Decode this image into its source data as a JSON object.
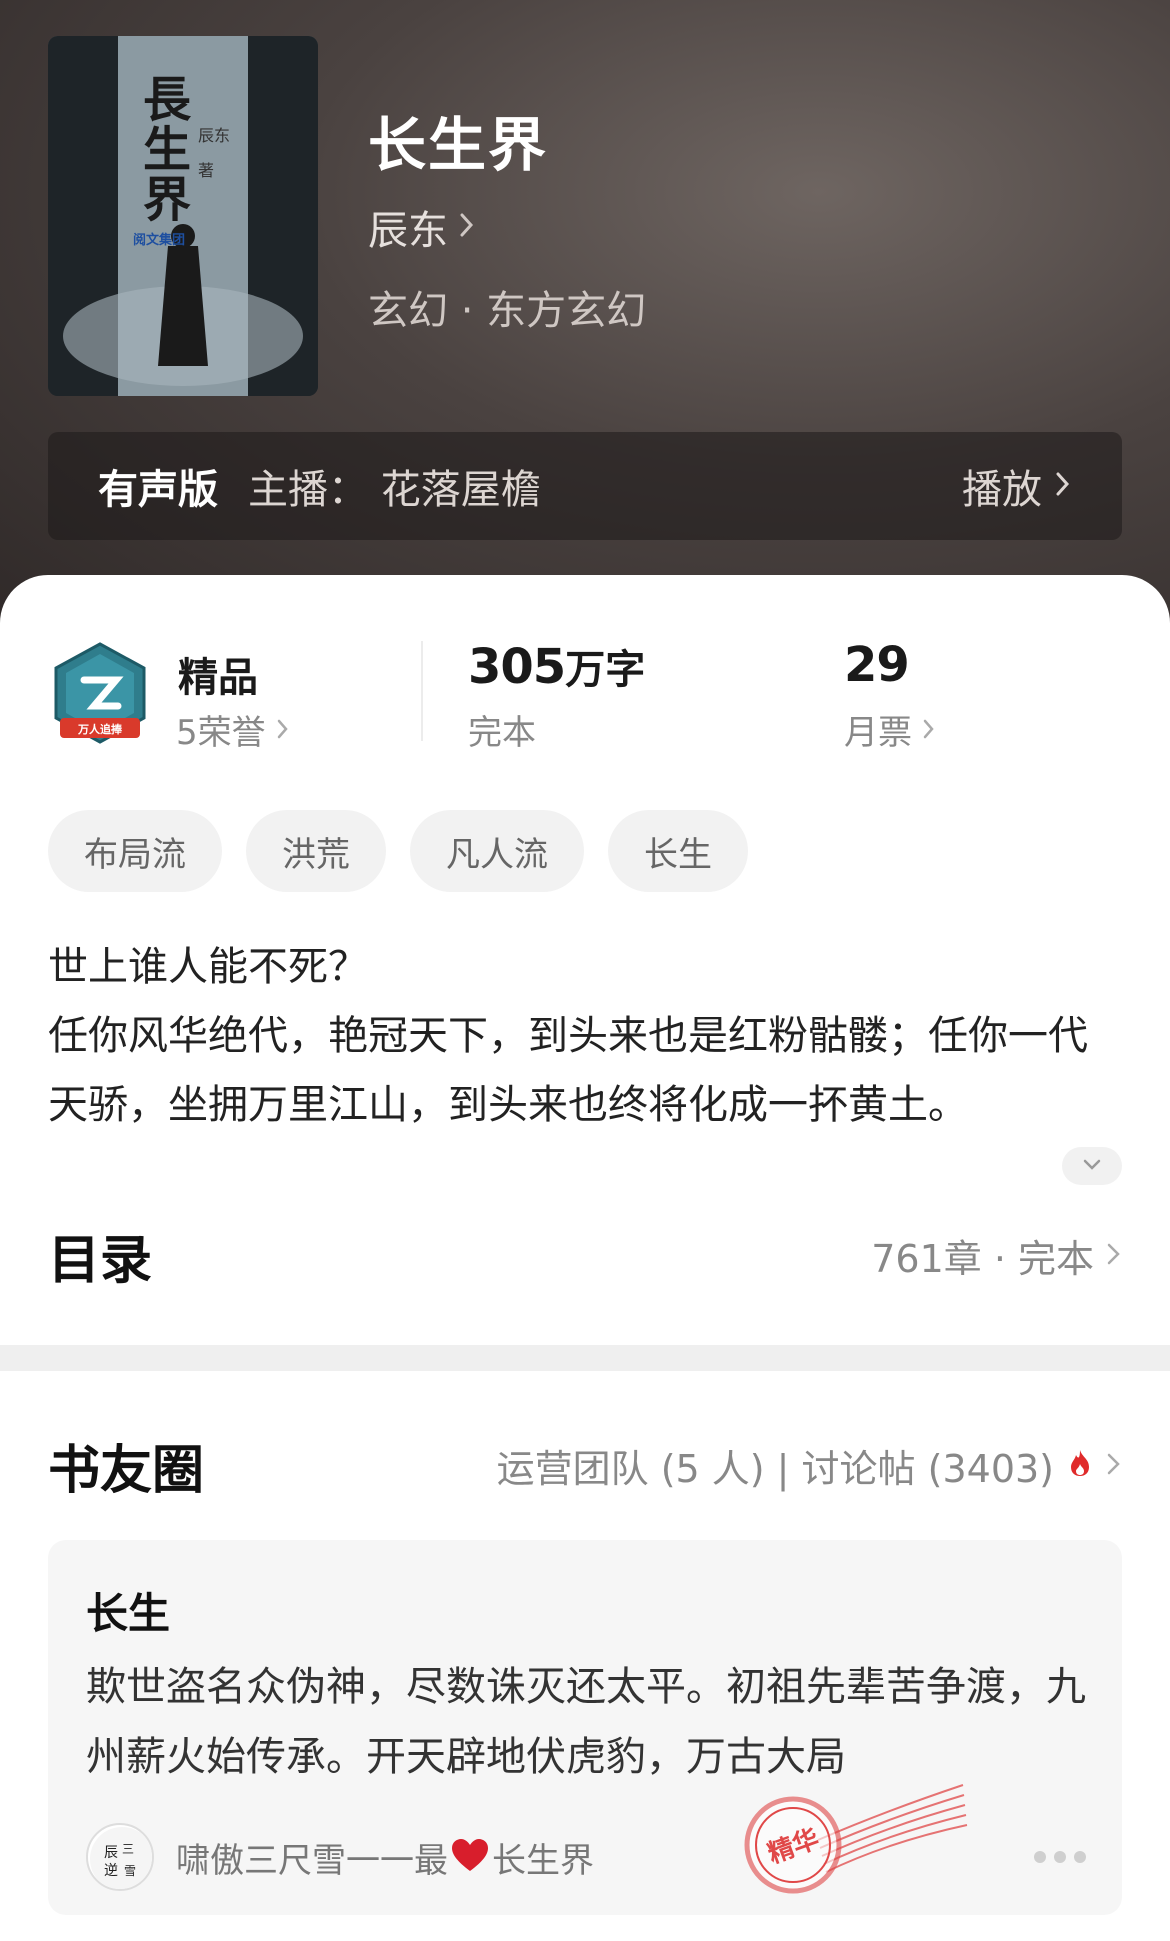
{
  "header": {
    "book_title": "长生界",
    "author": "辰东",
    "genre": "玄幻 · 东方玄幻",
    "cover": {
      "title_text": "長生界",
      "author_text": "辰东 著",
      "publisher_text": "阅文集团"
    },
    "audio": {
      "label": "有声版",
      "host": "主播：  花落屋檐",
      "play_label": "播放"
    }
  },
  "stats": {
    "badge_label": "万人追捧",
    "quality_title": "精品",
    "honors": "5荣誉",
    "word_count": "305",
    "word_unit": "万字",
    "status": "完本",
    "monthly_tickets": "29",
    "monthly_label": "月票"
  },
  "tags": [
    "布局流",
    "洪荒",
    "凡人流",
    "长生"
  ],
  "synopsis": "世上谁人能不死？\n任你风华绝代，艳冠天下，到头来也是红粉骷髅；任你一代天骄，坐拥万里江山，到头来也终将化成一抔黄土。",
  "toc": {
    "title": "目录",
    "info": "761章 · 完本"
  },
  "circle": {
    "title": "书友圈",
    "info": "运营团队 (5 人) | 讨论帖 (3403)"
  },
  "post": {
    "title": "长生",
    "body": "欺世盗名众伪神，尽数诛灭还太平。初祖先辈苦争渡，九州薪火始传承。开天辟地伏虎豹，万古大局",
    "author": "啸傲三尺雪一一最",
    "book": "长生界",
    "stamp_text": "精华"
  },
  "colors": {
    "hero_bg": "#3d3533",
    "accent_red": "#e02b2b",
    "tag_bg": "#f2f2f2",
    "text_gray": "#888888"
  }
}
